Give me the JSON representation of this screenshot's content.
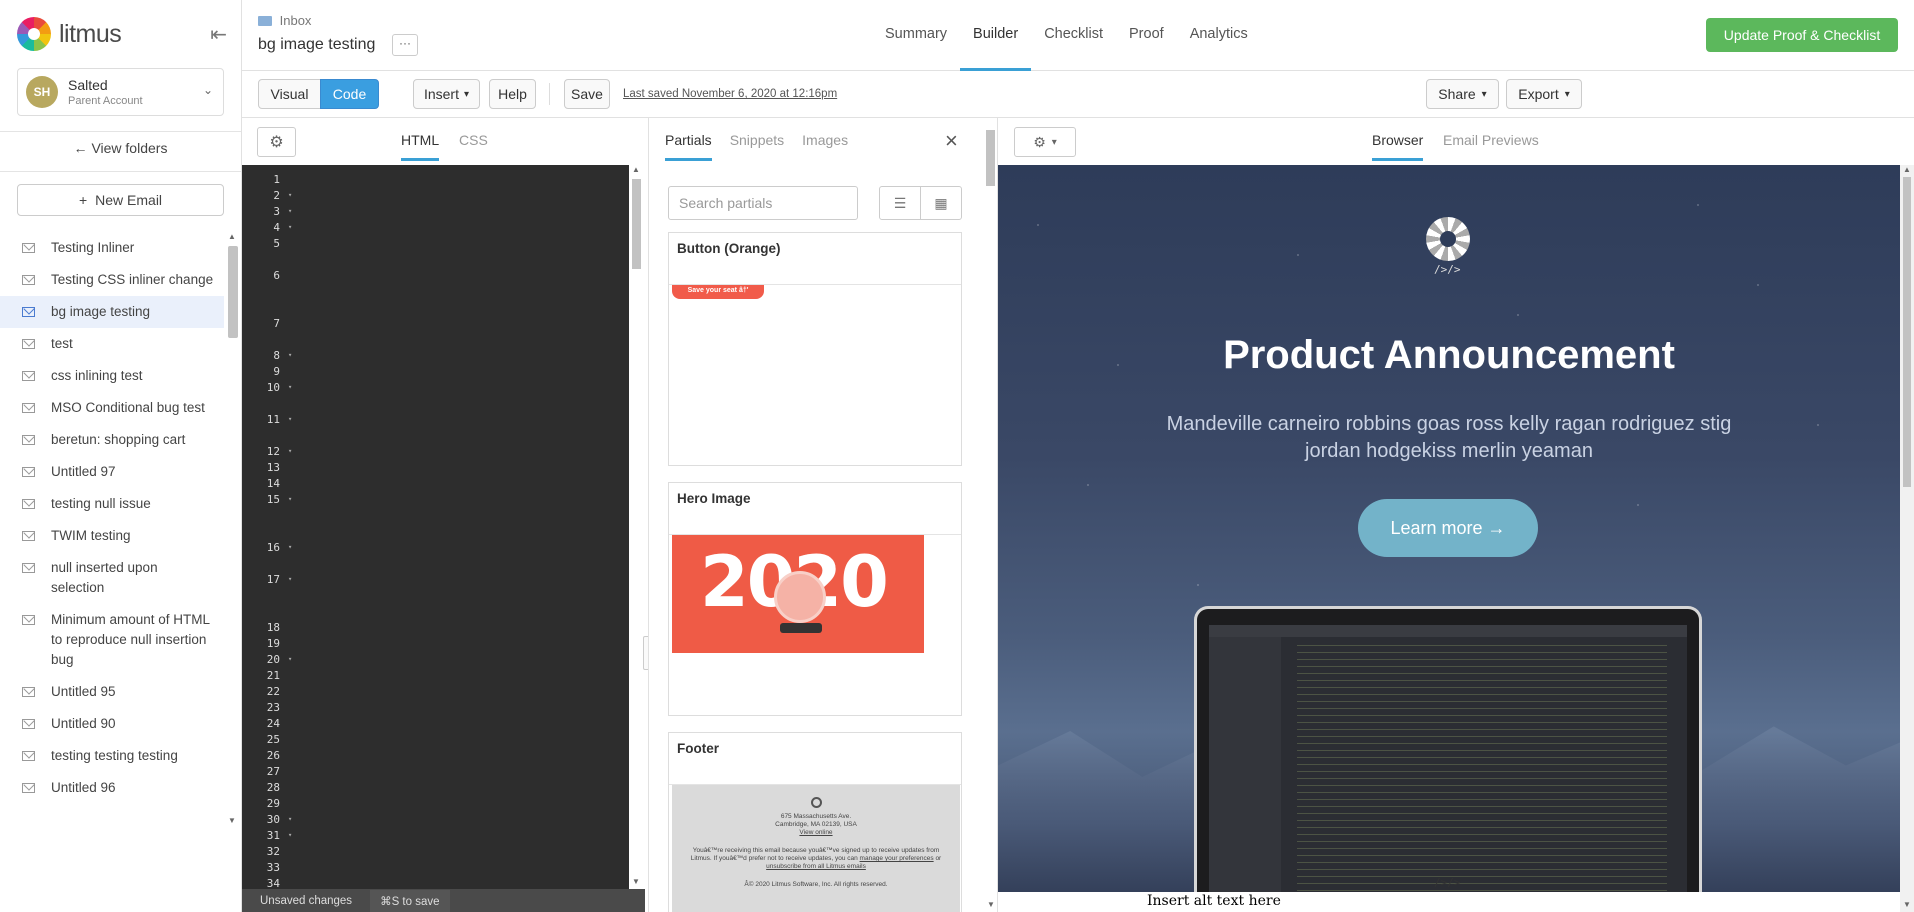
{
  "app": {
    "logo": "litmus"
  },
  "sidebar": {
    "account": {
      "initials": "SH",
      "name": "Salted",
      "role": "Parent Account"
    },
    "view_folders": "View folders",
    "new_email": "New Email",
    "items": [
      {
        "label": "Testing Inliner"
      },
      {
        "label": "Testing CSS inliner change"
      },
      {
        "label": "bg image testing",
        "active": true
      },
      {
        "label": "test"
      },
      {
        "label": "css inlining test"
      },
      {
        "label": "MSO Conditional bug test"
      },
      {
        "label": "beretun: shopping cart"
      },
      {
        "label": "Untitled 97"
      },
      {
        "label": "testing null issue"
      },
      {
        "label": "TWIM testing"
      },
      {
        "label": "null inserted upon selection"
      },
      {
        "label": "Minimum amount of HTML to reproduce null insertion bug"
      },
      {
        "label": "Untitled 95"
      },
      {
        "label": "Untitled 90"
      },
      {
        "label": "testing testing testing"
      },
      {
        "label": "Untitled 96"
      }
    ]
  },
  "header": {
    "breadcrumb": "Inbox",
    "title": "bg image testing",
    "more": "···",
    "nav": [
      "Summary",
      "Builder",
      "Checklist",
      "Proof",
      "Analytics"
    ],
    "active_nav": "Builder",
    "primary_action": "Update Proof & Checklist"
  },
  "toolbar": {
    "visual": "Visual",
    "code": "Code",
    "insert": "Insert",
    "help": "Help",
    "save": "Save",
    "last_saved": "Last saved November 6, 2020 at 12:16pm",
    "share": "Share",
    "export": "Export"
  },
  "code_pane": {
    "tabs": [
      "HTML",
      "CSS"
    ],
    "active_tab": "HTML",
    "status": {
      "unsaved": "Unsaved changes",
      "save_hint": "⌘S to save"
    }
  },
  "partials": {
    "tabs": [
      "Partials",
      "Snippets",
      "Images"
    ],
    "active_tab": "Partials",
    "search_placeholder": "Search partials",
    "cards": [
      {
        "title": "Button (Orange)",
        "preview_text": "Save your seat â†'"
      },
      {
        "title": "Hero Image",
        "preview_text": "2020"
      },
      {
        "title": "Footer",
        "address1": "675 Massachusetts Ave.",
        "address2": "Cambridge, MA 02139, USA",
        "view_online": "View online",
        "note_line1": "Youâ€™re receiving this email because youâ€™ve signed up to receive updates from Litmus. If",
        "note_line2": "youâ€™d prefer not to receive updates, you can",
        "manage_prefs": "manage your preferences",
        "note_or": "or",
        "unsubscribe": "unsubscribe from all Litmus emails",
        "copyright": "Â© 2020 Litmus Software, Inc. All rights reserved."
      }
    ]
  },
  "preview": {
    "tabs": [
      "Browser",
      "Email Previews"
    ],
    "active_tab": "Browser",
    "logo_code": "/>/>",
    "title": "Product Announcement",
    "subtitle": "Mandeville carneiro robbins goas ross kelly ragan rodriguez stig jordan hodgekiss merlin yeaman",
    "cta": "Learn more →",
    "alt_text": "Insert alt text here"
  },
  "colors": {
    "accent": "#3aa0d5",
    "primary_green": "#5cb85c",
    "code_blue": "#3a9ee0",
    "editor_bg": "#2d2d2d",
    "hero_orange": "#ef5b46"
  }
}
